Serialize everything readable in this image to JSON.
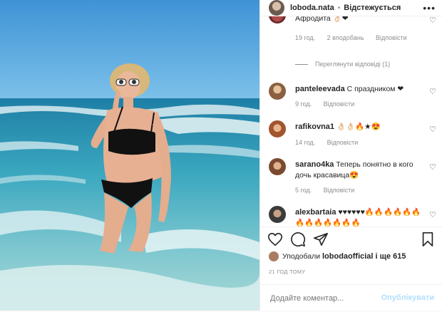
{
  "header": {
    "username": "loboda.nata",
    "separator": "•",
    "follow_label": "Відстежується",
    "more_label": "•••"
  },
  "comments": [
    {
      "username": "",
      "text": "Афродита 👌🏻❤",
      "time": "19 год.",
      "likes": "2 вподобань",
      "reply": "Відповісти"
    },
    {
      "view_replies": "Переглянути відповіді (1)"
    },
    {
      "username": "panteleevada",
      "text": "С праздником ❤",
      "time": "9 год.",
      "reply": "Відповісти"
    },
    {
      "username": "rafikovna1",
      "text": "👌🏻👌🏻🔥★😍",
      "time": "14 год.",
      "reply": "Відповісти"
    },
    {
      "username": "sarano4ka",
      "text": "Теперь понятно в кого дочь красавица😍",
      "time": "5 год.",
      "reply": "Відповісти"
    },
    {
      "username": "alexbartaia",
      "text": "♥♥♥♥♥♥🔥🔥🔥🔥🔥🔥🔥🔥🔥🔥🔥🔥🔥"
    }
  ],
  "actions": {
    "icons": [
      "heart-icon",
      "comment-icon",
      "share-icon",
      "bookmark-icon"
    ],
    "likes_prefix": "Уподобали ",
    "likes_user": "lobodaofficial",
    "likes_suffix": " і ще 615",
    "timestamp": "21 ГОД ТОМУ"
  },
  "add_comment": {
    "placeholder": "Додайте коментар...",
    "publish_label": "Опублікувати"
  },
  "colors": {
    "publish": "#b2dffc",
    "text": "#262626",
    "muted": "#8e8e8e",
    "sea": "#2f9bb5",
    "sky": "#4aa5dc"
  }
}
